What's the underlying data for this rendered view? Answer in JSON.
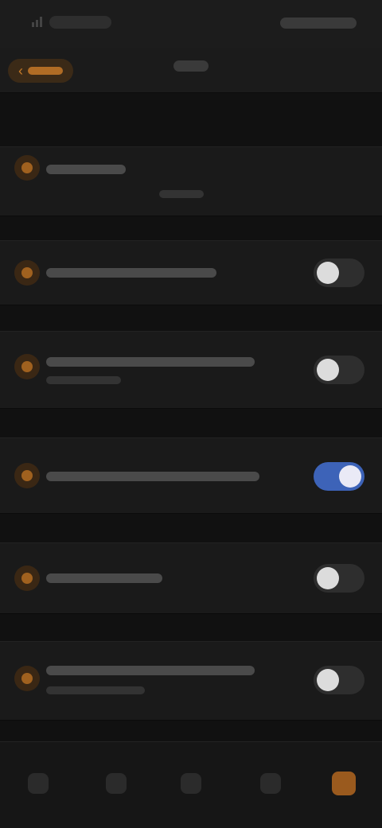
{
  "status_bar": {
    "icons": [
      "signal-icon",
      "battery-icon"
    ]
  },
  "header": {
    "back_icon": "chevron-left-icon",
    "back_label": "",
    "title": ""
  },
  "section": {
    "title": "",
    "subtitle": ""
  },
  "settings": [
    {
      "icon": "setting-icon-1",
      "label": "",
      "description": "",
      "on": false
    },
    {
      "icon": "setting-icon-2",
      "label": "",
      "description": "",
      "on": false
    },
    {
      "icon": "setting-icon-3",
      "label": "",
      "description": "",
      "on": true
    },
    {
      "icon": "setting-icon-4",
      "label": "",
      "description": "",
      "on": false
    },
    {
      "icon": "setting-icon-5",
      "label": "",
      "description": "",
      "on": false
    }
  ],
  "bottom_nav": [
    {
      "icon": "home-icon",
      "active": false
    },
    {
      "icon": "list-icon",
      "active": false
    },
    {
      "icon": "apps-icon",
      "active": false
    },
    {
      "icon": "profile-icon",
      "active": false
    },
    {
      "icon": "settings-icon",
      "active": true
    }
  ],
  "colors": {
    "background": "#111111",
    "accent": "#b06c25",
    "toggle_on": "#3d63b8"
  }
}
